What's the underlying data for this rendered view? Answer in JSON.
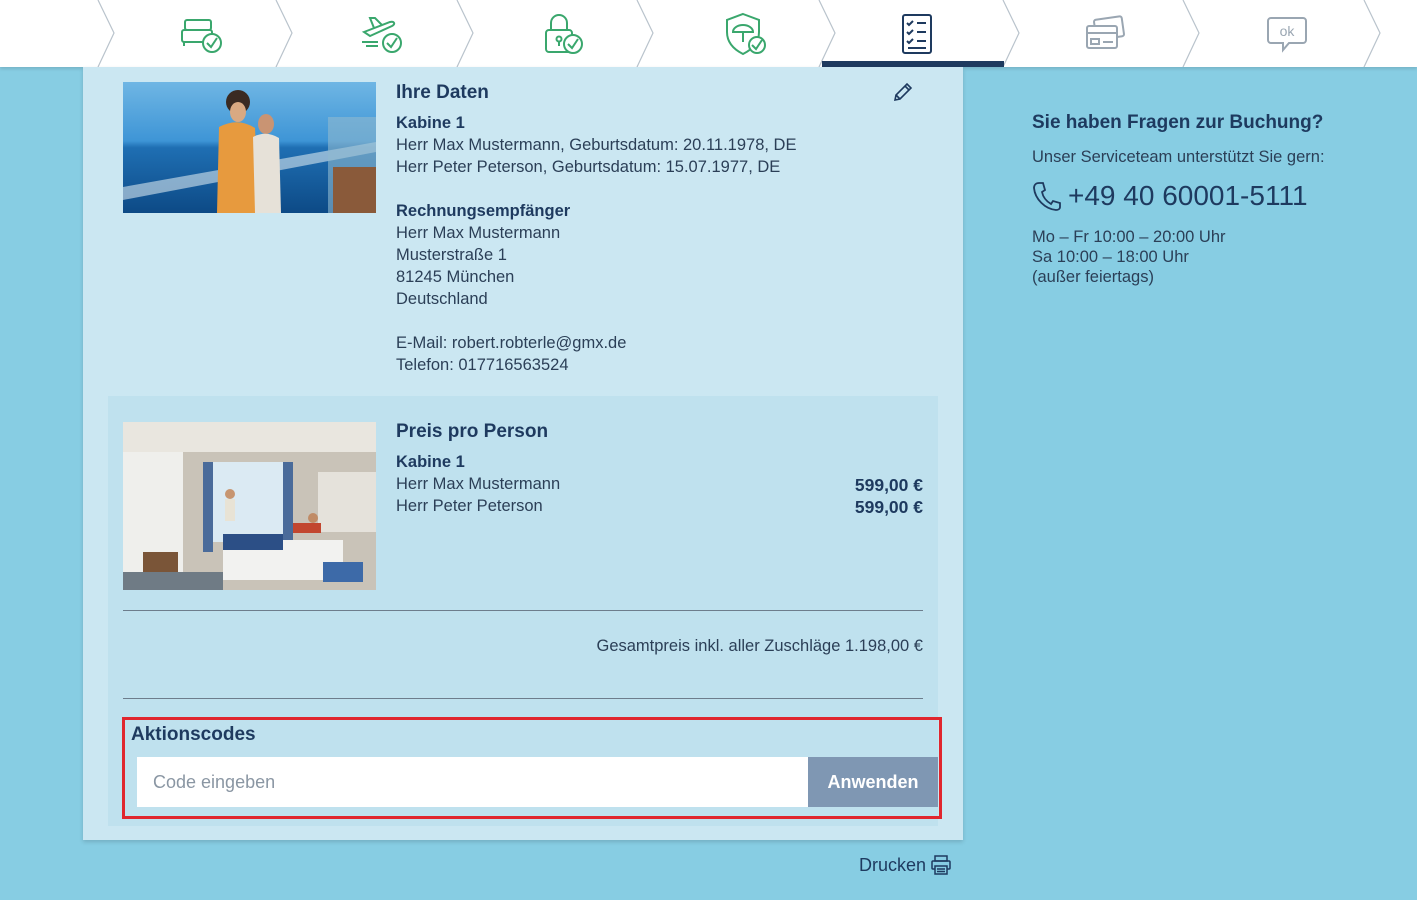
{
  "stepper": {
    "steps": [
      {
        "icon": "cabin-check-icon",
        "state": "done"
      },
      {
        "icon": "flight-check-icon",
        "state": "done"
      },
      {
        "icon": "lock-check-icon",
        "state": "done"
      },
      {
        "icon": "insurance-check-icon",
        "state": "done"
      },
      {
        "icon": "checklist-icon",
        "state": "active"
      },
      {
        "icon": "payment-card-icon",
        "state": "pending"
      },
      {
        "icon": "ok-bubble-icon",
        "state": "pending"
      }
    ],
    "done_color": "#3aa76d",
    "active_color": "#1e3a5f",
    "pending_color": "#9aa6b2",
    "ok_label": "ok"
  },
  "your_data": {
    "title": "Ihre Daten",
    "cabin_label": "Kabine 1",
    "travellers": [
      "Herr Max Mustermann, Geburtsdatum: 20.11.1978, DE",
      "Herr Peter Peterson, Geburtsdatum: 15.07.1977, DE"
    ],
    "billing_title": "Rechnungsempfänger",
    "billing_lines": [
      "Herr Max Mustermann",
      "Musterstraße 1",
      "81245 München",
      "Deutschland"
    ],
    "email": "E-Mail: robert.robterle@gmx.de",
    "phone": "Telefon: 017716563524"
  },
  "price_per_person": {
    "title": "Preis pro Person",
    "cabin_label": "Kabine 1",
    "rows": [
      {
        "name": "Herr Max Mustermann",
        "price": "599,00 €"
      },
      {
        "name": "Herr Peter Peterson",
        "price": "599,00 €"
      }
    ],
    "total": "Gesamtpreis inkl. aller Zuschläge 1.198,00 €"
  },
  "promo": {
    "title": "Aktionscodes",
    "placeholder": "Code eingeben",
    "button": "Anwenden"
  },
  "print_label": "Drucken",
  "side": {
    "title": "Sie haben Fragen zur Buchung?",
    "subtitle": "Unser Serviceteam unterstützt Sie gern:",
    "phone": "+49 40 60001-5111",
    "hours": [
      "Mo – Fr 10:00 – 20:00 Uhr",
      "Sa 10:00 – 18:00 Uhr",
      "(außer feiertags)"
    ]
  }
}
